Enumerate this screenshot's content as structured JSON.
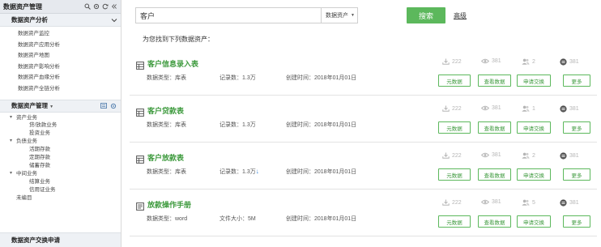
{
  "sidebar": {
    "title": "数据资产管理",
    "section1": {
      "title": "数据资产分析",
      "items": [
        "数据资产监控",
        "数据资产应用分析",
        "数据资产地图",
        "数据资产影响分析",
        "数据资产血缘分析",
        "数据资产全链分析"
      ]
    },
    "section2": {
      "title": "数据资产管理",
      "tree": [
        {
          "label": "资产业务",
          "level": 1,
          "caret": "▾"
        },
        {
          "label": "贷/放款业务",
          "level": 2
        },
        {
          "label": "投资业务",
          "level": 2
        },
        {
          "label": "负债业务",
          "level": 1,
          "caret": "▾"
        },
        {
          "label": "活期存款",
          "level": 2
        },
        {
          "label": "定期存款",
          "level": 2
        },
        {
          "label": "储蓄存款",
          "level": 2
        },
        {
          "label": "中间业务",
          "level": 1,
          "caret": "▾"
        },
        {
          "label": "结算业务",
          "level": 2
        },
        {
          "label": "信用证业务",
          "level": 2
        },
        {
          "label": "未编目",
          "level": 1
        }
      ]
    },
    "footer": "数据资产交换申请"
  },
  "search": {
    "value": "客户",
    "type_label": "数据资产",
    "button_label": "搜索",
    "advanced_label": "高级"
  },
  "found_text": "为您找到下列数据资产：",
  "labels": {
    "type_prefix": "数据类型：",
    "records_prefix": "记录数：",
    "size_prefix": "文件大小：",
    "created_prefix": "创建时间：",
    "btn_meta": "元数据",
    "btn_view": "查看数据",
    "btn_exchange": "申请交换",
    "btn_more": "更多"
  },
  "results": [
    {
      "title": "客户信息录入表",
      "icon": "table-icon",
      "type": "库表",
      "extra": "1.3万",
      "created": "2018年01月01日",
      "downloads": "222",
      "views": "381",
      "users": "2",
      "favorites": "381"
    },
    {
      "title": "客户贷款表",
      "icon": "table-icon",
      "type": "库表",
      "extra": "1.3万",
      "created": "2018年01月01日",
      "downloads": "222",
      "views": "381",
      "users": "1",
      "favorites": "381"
    },
    {
      "title": "客户放款表",
      "icon": "table-icon",
      "type": "库表",
      "extra": "1.3万",
      "created": "2018年01月01日",
      "downloads": "222",
      "views": "381",
      "users": "2",
      "favorites": "381"
    },
    {
      "title": "放款操作手册",
      "icon": "document-icon",
      "type": "word",
      "extra": "5M",
      "created": "2018年01月01日",
      "downloads": "222",
      "views": "381",
      "users": "5",
      "favorites": "381"
    }
  ],
  "colors": {
    "accent": "#5cb85c",
    "title_green": "#3d9a3d",
    "arrow_blue": "#2b7fd6"
  }
}
